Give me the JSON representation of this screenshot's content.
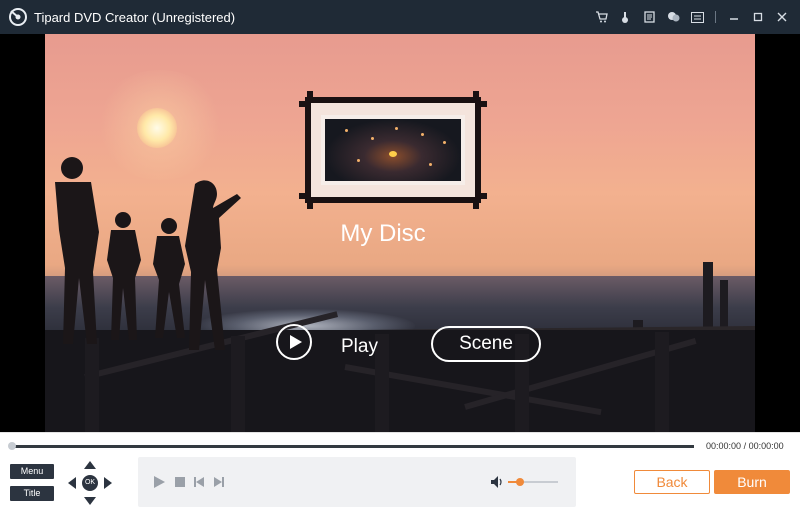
{
  "window": {
    "title": "Tipard DVD Creator (Unregistered)",
    "icons": [
      "cart-icon",
      "key-icon",
      "register-icon",
      "feedback-icon",
      "menu-icon",
      "minimize-icon",
      "maximize-icon",
      "close-icon"
    ]
  },
  "menu_preview": {
    "disc_title": "My Disc",
    "play_label": "Play",
    "scene_label": "Scene"
  },
  "timeline": {
    "current_time": "00:00:00",
    "separator": "/",
    "total_time": "00:00:00",
    "progress": 0
  },
  "controls": {
    "menu_label": "Menu",
    "title_label": "Title",
    "ok_label": "OK",
    "volume_level": 0.25
  },
  "actions": {
    "back_label": "Back",
    "burn_label": "Burn"
  },
  "colors": {
    "titlebar_bg": "#1f2a36",
    "accent": "#f08a3a",
    "control_dark": "#2c3440"
  }
}
